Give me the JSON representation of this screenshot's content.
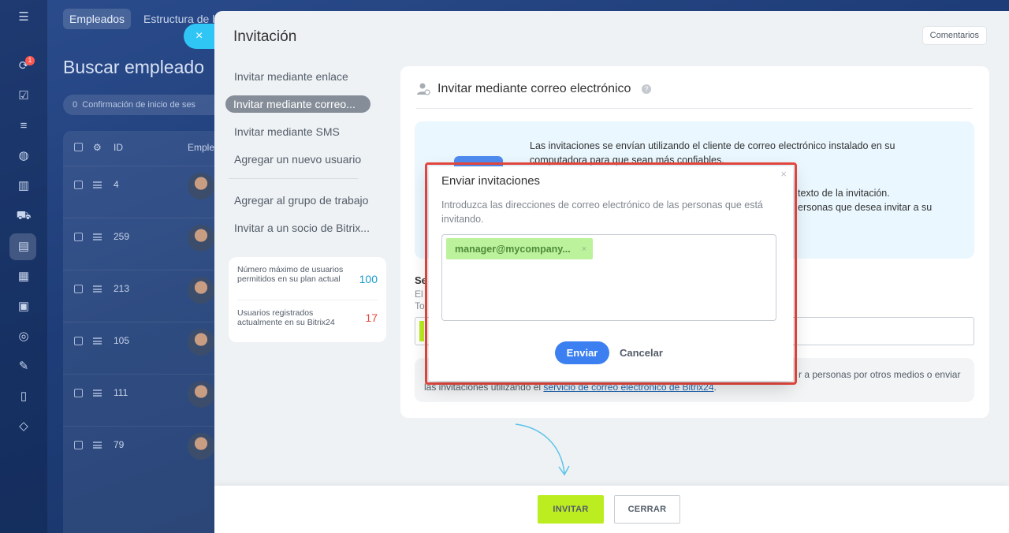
{
  "background": {
    "tabs": [
      "Empleados",
      "Estructura de l"
    ],
    "title": "Buscar empleado",
    "filter": "Confirmación de inicio de ses",
    "filter_count": "0",
    "table_headers": [
      "ID",
      "Emple"
    ],
    "rows": [
      {
        "id": "4"
      },
      {
        "id": "259"
      },
      {
        "id": "213"
      },
      {
        "id": "105"
      },
      {
        "id": "111"
      },
      {
        "id": "79"
      }
    ],
    "notification_count": "1"
  },
  "slider": {
    "close_icon": "×",
    "title": "Invitación",
    "comments_label": "Comentarios"
  },
  "menu": {
    "items": [
      "Invitar mediante enlace",
      "Invitar mediante correo...",
      "Invitar mediante SMS",
      "Agregar un nuevo usuario"
    ],
    "items2": [
      "Agregar al grupo de trabajo",
      "Invitar a un socio de Bitrix..."
    ]
  },
  "stats": {
    "max_users_label": "Número máximo de usuarios permitidos en su plan actual",
    "max_users_value": "100",
    "registered_label": "Usuarios registrados actualmente en su Bitrix24",
    "registered_value": "17"
  },
  "content": {
    "title": "Invitar mediante correo electrónico",
    "help": "?",
    "info_line1": "Las invitaciones se envían utilizando el cliente de correo electrónico instalado en su",
    "info_line2": "computadora para que sean más confiables.",
    "info_line3": "texto de la invitación.",
    "info_line4": "ersonas que desea invitar a su",
    "section_label": "Se",
    "section_sub1": "El",
    "section_sub2": "To",
    "note_right": "r a personas por otros medios o enviar",
    "note_left_prefix": "las invitaciones utilizando el ",
    "note_link": "servicio de correo electrónico de Bitrix24",
    "note_suffix": "."
  },
  "popup": {
    "close": "×",
    "title": "Enviar invitaciones",
    "description": "Introduzca las direcciones de correo electrónico de las personas que está invitando.",
    "email_chip": "manager@mycompany...",
    "chip_remove": "×",
    "send_label": "Enviar",
    "cancel_label": "Cancelar"
  },
  "footer": {
    "invite_label": "INVITAR",
    "close_label": "CERRAR"
  },
  "colors": {
    "accent_green": "#bbed21",
    "primary_blue": "#3b7ff1",
    "highlight_red": "#e8483f",
    "slider_close": "#2fc6f6",
    "max_value": "#1b9acb",
    "registered_value": "#e8483f"
  },
  "icons": [
    "menu-icon",
    "pulse-icon",
    "tasks-icon",
    "filter-icon",
    "robot-icon",
    "chart-icon",
    "cart-icon",
    "contact-card-icon",
    "calendar-icon",
    "archive-icon",
    "target-icon",
    "pen-icon",
    "document-icon",
    "box-icon",
    "user-icon",
    "help-icon",
    "arrow-icon"
  ]
}
